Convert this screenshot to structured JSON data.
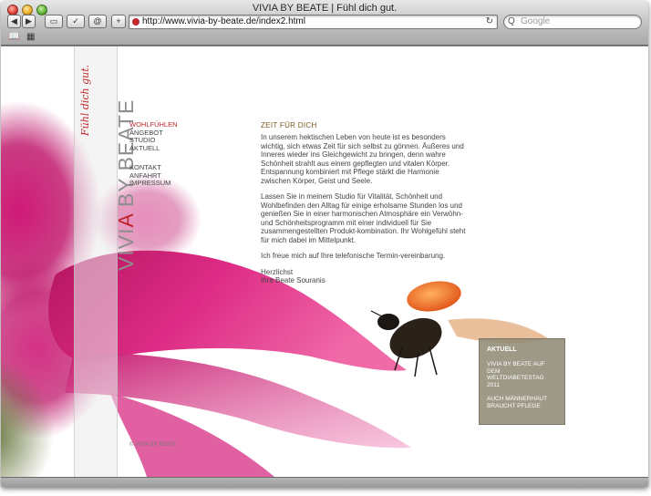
{
  "window": {
    "title": "VIVIA BY BEATE | Fühl dich gut."
  },
  "toolbar": {
    "back_icon": "◀",
    "forward_icon": "▶",
    "screen_icon": "▭",
    "check_icon": "✓",
    "at_icon": "@",
    "add_icon": "+",
    "url": "http://www.vivia-by-beate.de/index2.html",
    "reload_icon": "↻",
    "search_placeholder": "Google",
    "search_icon": "Q",
    "bookmarks_icon": "📖",
    "grid_icon": "▦"
  },
  "site": {
    "logo_part1": "VIVI",
    "logo_part2": "A",
    "logo_part3": " BY BEATE",
    "logo_tagline": "Fühl dich gut.",
    "nav_primary": [
      "WOHLFÜHLEN",
      "ANGEBOT",
      "STUDIO",
      "AKTUELL"
    ],
    "nav_secondary": [
      "KONTAKT",
      "ANFAHRT",
      "IMPRESSUM"
    ],
    "content": {
      "heading": "ZEIT FÜR DICH",
      "paragraph1": "In unserem hektischen Leben von heute ist es besonders wichtig, sich etwas Zeit für sich selbst zu gönnen. Äußeres und Inneres wieder ins Gleichgewicht zu bringen, denn wahre Schönheit strahlt aus einem gepflegten und vitalen Körper. Entspannung kombiniert mit Pflege stärkt die Harmonie zwischen Körper, Geist und Seele.",
      "paragraph2": "Lassen Sie in meinem Studio für Vitalität, Schönheit und Wohlbefinden den Alltag für einige erholsame Stunden los und genießen Sie in einer harmonischen Atmosphäre ein Verwöhn- und Schönheitsprogramm mit einer individuell für Sie zusammengestellten Produkt-kombination. Ihr Wohlgefühl steht für mich dabei im Mittelpunkt.",
      "paragraph3": "Ich freue mich auf Ihre telefonische Termin-vereinbarung.",
      "signoff1": "Herzlichst",
      "signoff2": "Ihre Beate Souranis"
    },
    "news": {
      "heading": "AKTUELL",
      "item1": "VIVIA BY BEATE AUF DEM WELTDIABETESTAG 2011",
      "item2": "AUCH MÄNNERHAUT BRAUCHT PFLEGE"
    },
    "copyright": "© VIVIA BY BEATE"
  },
  "colors": {
    "accent_red": "#c0272d",
    "heading_brown": "#7b5a1e",
    "news_box": "#918c76",
    "petal_pink": "#d6217d"
  }
}
